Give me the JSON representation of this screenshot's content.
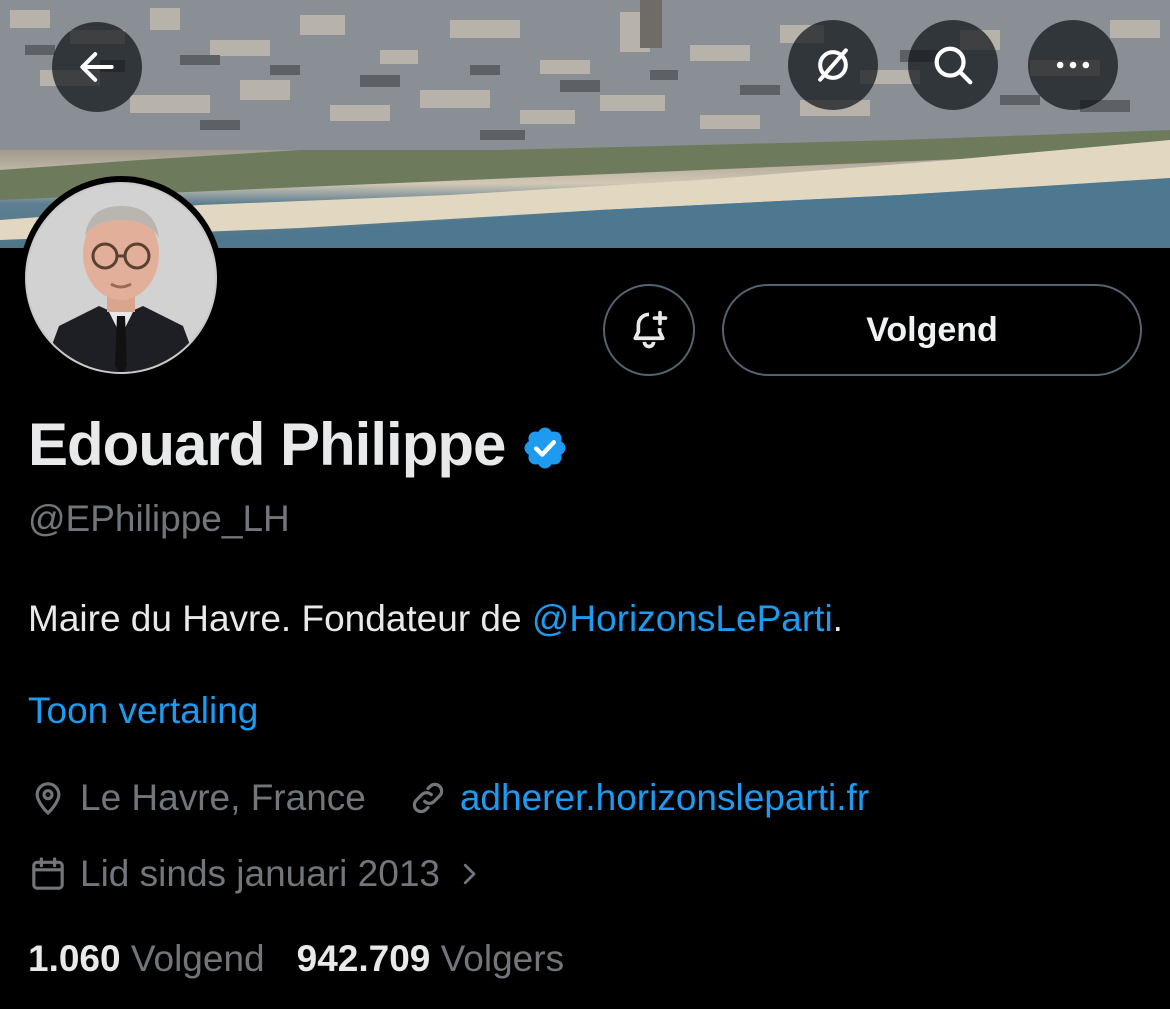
{
  "header": {
    "back_icon": "arrow-left-icon",
    "actions": [
      "hide-icon",
      "search-icon",
      "more-icon"
    ]
  },
  "profile": {
    "name": "Edouard Philippe",
    "verified": true,
    "handle": "@EPhilippe_LH",
    "bio_text": "Maire du Havre. Fondateur de ",
    "bio_mention": "@HorizonsLeParti",
    "bio_suffix": ".",
    "translate_label": "Toon vertaling",
    "location": "Le Havre, France",
    "website": "adherer.horizonsleparti.fr",
    "joined": "Lid sinds januari 2013"
  },
  "actions": {
    "notify_icon": "bell-plus-icon",
    "follow_label": "Volgend"
  },
  "stats": {
    "following_count": "1.060",
    "following_label": "Volgend",
    "followers_count": "942.709",
    "followers_label": "Volgers"
  },
  "colors": {
    "background": "#000000",
    "accent": "#1d9bf0",
    "secondary_text": "#71767b",
    "border": "#536471"
  }
}
